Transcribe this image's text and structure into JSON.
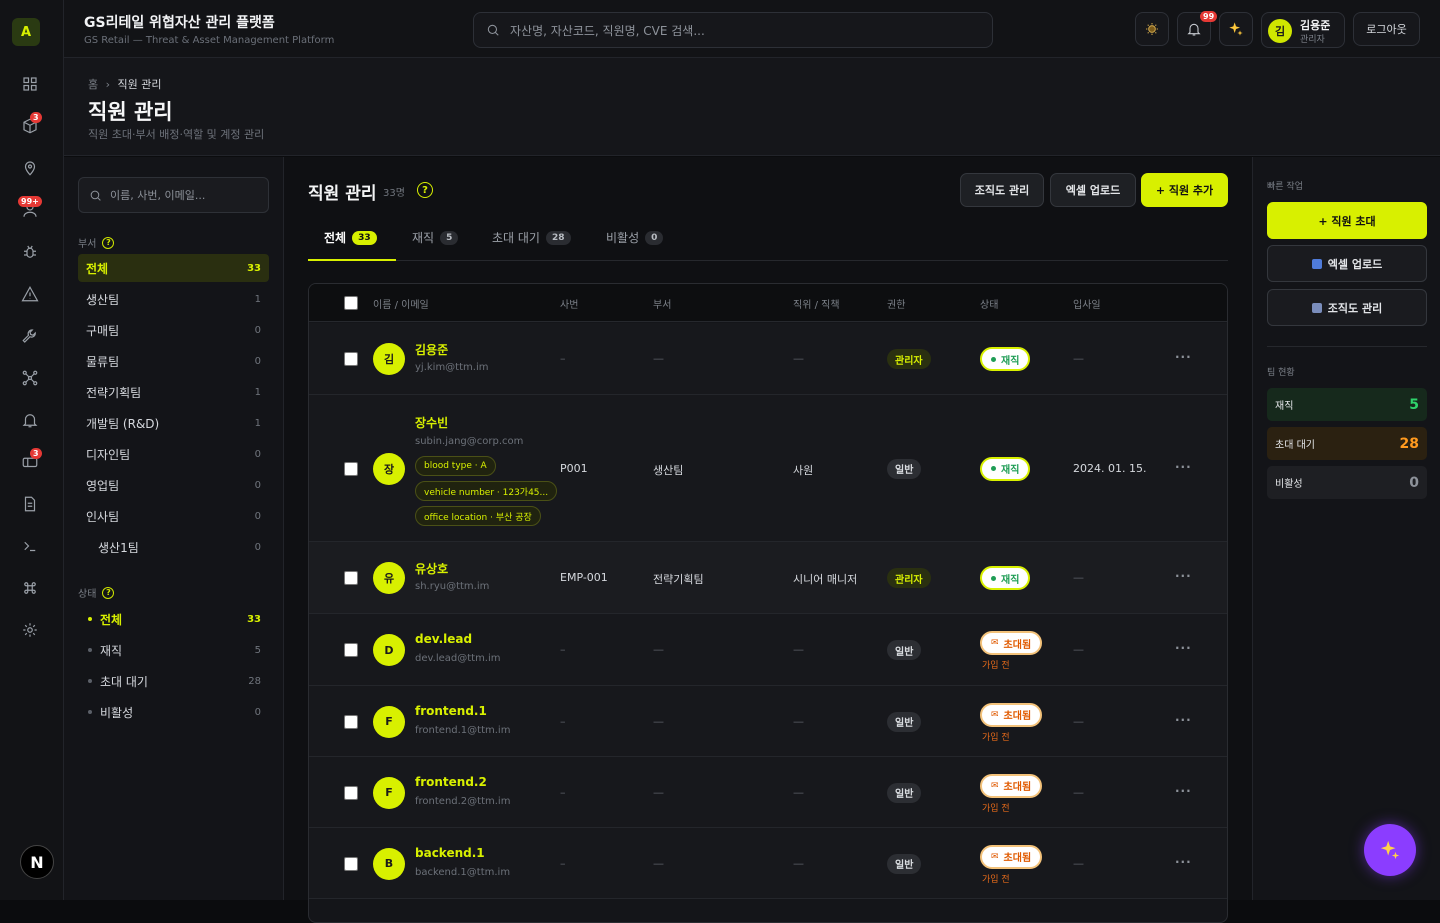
{
  "app": {
    "logo_letter": "A",
    "title": "GS리테일 위협자산 관리 플랫폼",
    "subtitle": "GS Retail — Threat & Asset Management Platform"
  },
  "search": {
    "placeholder": "자산명, 자산코드, 직원명, CVE 검색..."
  },
  "rail_badges": {
    "assets": "3",
    "people": "99+",
    "tickets": "3"
  },
  "rail_bottom": "N",
  "topbar": {
    "notif_badge": "99",
    "user_initial": "김",
    "user_name": "김용준",
    "user_role": "관리자",
    "logout_label": "로그아웃"
  },
  "header": {
    "breadcrumb_home": "홈",
    "breadcrumb_sep": "›",
    "breadcrumb_current": "직원 관리",
    "title": "직원 관리",
    "subtitle": "직원 초대·부서 배정·역할 및 계정 관리"
  },
  "left": {
    "search_placeholder": "이름, 사번, 이메일...",
    "dept_label": "부서",
    "departments": [
      {
        "name": "전체",
        "count": "33"
      },
      {
        "name": "생산팀",
        "count": "1"
      },
      {
        "name": "구매팀",
        "count": "0"
      },
      {
        "name": "물류팀",
        "count": "0"
      },
      {
        "name": "전략기획팀",
        "count": "1"
      },
      {
        "name": "개발팀 (R&D)",
        "count": "1"
      },
      {
        "name": "디자인팀",
        "count": "0"
      },
      {
        "name": "영업팀",
        "count": "0"
      },
      {
        "name": "인사팀",
        "count": "0"
      },
      {
        "name": "생산1팀",
        "count": "0"
      }
    ],
    "status_label": "상태",
    "statuses": [
      {
        "name": "전체",
        "count": "33"
      },
      {
        "name": "재직",
        "count": "5"
      },
      {
        "name": "초대 대기",
        "count": "28"
      },
      {
        "name": "비활성",
        "count": "0"
      }
    ]
  },
  "main": {
    "title": "직원 관리",
    "count": "33명",
    "help": "?",
    "btn_org": "조직도 관리",
    "btn_excel": "엑셀 업로드",
    "btn_add": "+ 직원 추가",
    "tabs": [
      {
        "label": "전체",
        "count": "33"
      },
      {
        "label": "재직",
        "count": "5"
      },
      {
        "label": "초대 대기",
        "count": "28"
      },
      {
        "label": "비활성",
        "count": "0"
      }
    ],
    "columns": {
      "name": "이름 / 이메일",
      "emp_no": "사번",
      "dept": "부서",
      "position": "직위 / 직책",
      "role": "권한",
      "status": "상태",
      "joined": "입사일"
    },
    "rows": [
      {
        "initial": "김",
        "name": "김용준",
        "email": "yj.kim@ttm.im",
        "emp_no": "–",
        "dept": "—",
        "position": "—",
        "role": "관리자",
        "status": "재직",
        "joined": "—",
        "tags": []
      },
      {
        "initial": "장",
        "name": "장수빈",
        "email": "subin.jang@corp.com",
        "emp_no": "P001",
        "dept": "생산팀",
        "position": "사원",
        "role": "일반",
        "status": "재직",
        "joined": "2024. 01. 15.",
        "tags": [
          "blood type · A",
          "vehicle number · 123가45...",
          "office location · 부산 공장"
        ]
      },
      {
        "initial": "유",
        "name": "유상호",
        "email": "sh.ryu@ttm.im",
        "emp_no": "EMP-001",
        "dept": "전략기획팀",
        "position": "시니어 매니저",
        "role": "관리자",
        "status": "재직",
        "joined": "—",
        "tags": []
      },
      {
        "initial": "D",
        "name": "dev.lead",
        "email": "dev.lead@ttm.im",
        "emp_no": "–",
        "dept": "—",
        "position": "—",
        "role": "일반",
        "status": "초대됨",
        "sub": "가입 전",
        "joined": "—",
        "tags": []
      },
      {
        "initial": "F",
        "name": "frontend.1",
        "email": "frontend.1@ttm.im",
        "emp_no": "–",
        "dept": "—",
        "position": "—",
        "role": "일반",
        "status": "초대됨",
        "sub": "가입 전",
        "joined": "—",
        "tags": []
      },
      {
        "initial": "F",
        "name": "frontend.2",
        "email": "frontend.2@ttm.im",
        "emp_no": "–",
        "dept": "—",
        "position": "—",
        "role": "일반",
        "status": "초대됨",
        "sub": "가입 전",
        "joined": "—",
        "tags": []
      },
      {
        "initial": "B",
        "name": "backend.1",
        "email": "backend.1@ttm.im",
        "emp_no": "–",
        "dept": "—",
        "position": "—",
        "role": "일반",
        "status": "초대됨",
        "sub": "가입 전",
        "joined": "—",
        "tags": []
      }
    ],
    "more": "···"
  },
  "right": {
    "quick_label": "빠른 작업",
    "qa_invite": "+ 직원 초대",
    "qa_excel": "엑셀 업로드",
    "qa_org": "조직도 관리",
    "team_label": "팀 현황",
    "stats": [
      {
        "label": "재직",
        "value": "5",
        "color": "#2fd36b"
      },
      {
        "label": "초대 대기",
        "value": "28",
        "color": "#ff9a1f"
      },
      {
        "label": "비활성",
        "value": "0",
        "color": "#8d929a"
      }
    ]
  },
  "colors": {
    "accent": "#d8f000",
    "active_green": "#1f9d55",
    "invited_orange": "#e05a00",
    "fab": "#8b3dff"
  }
}
